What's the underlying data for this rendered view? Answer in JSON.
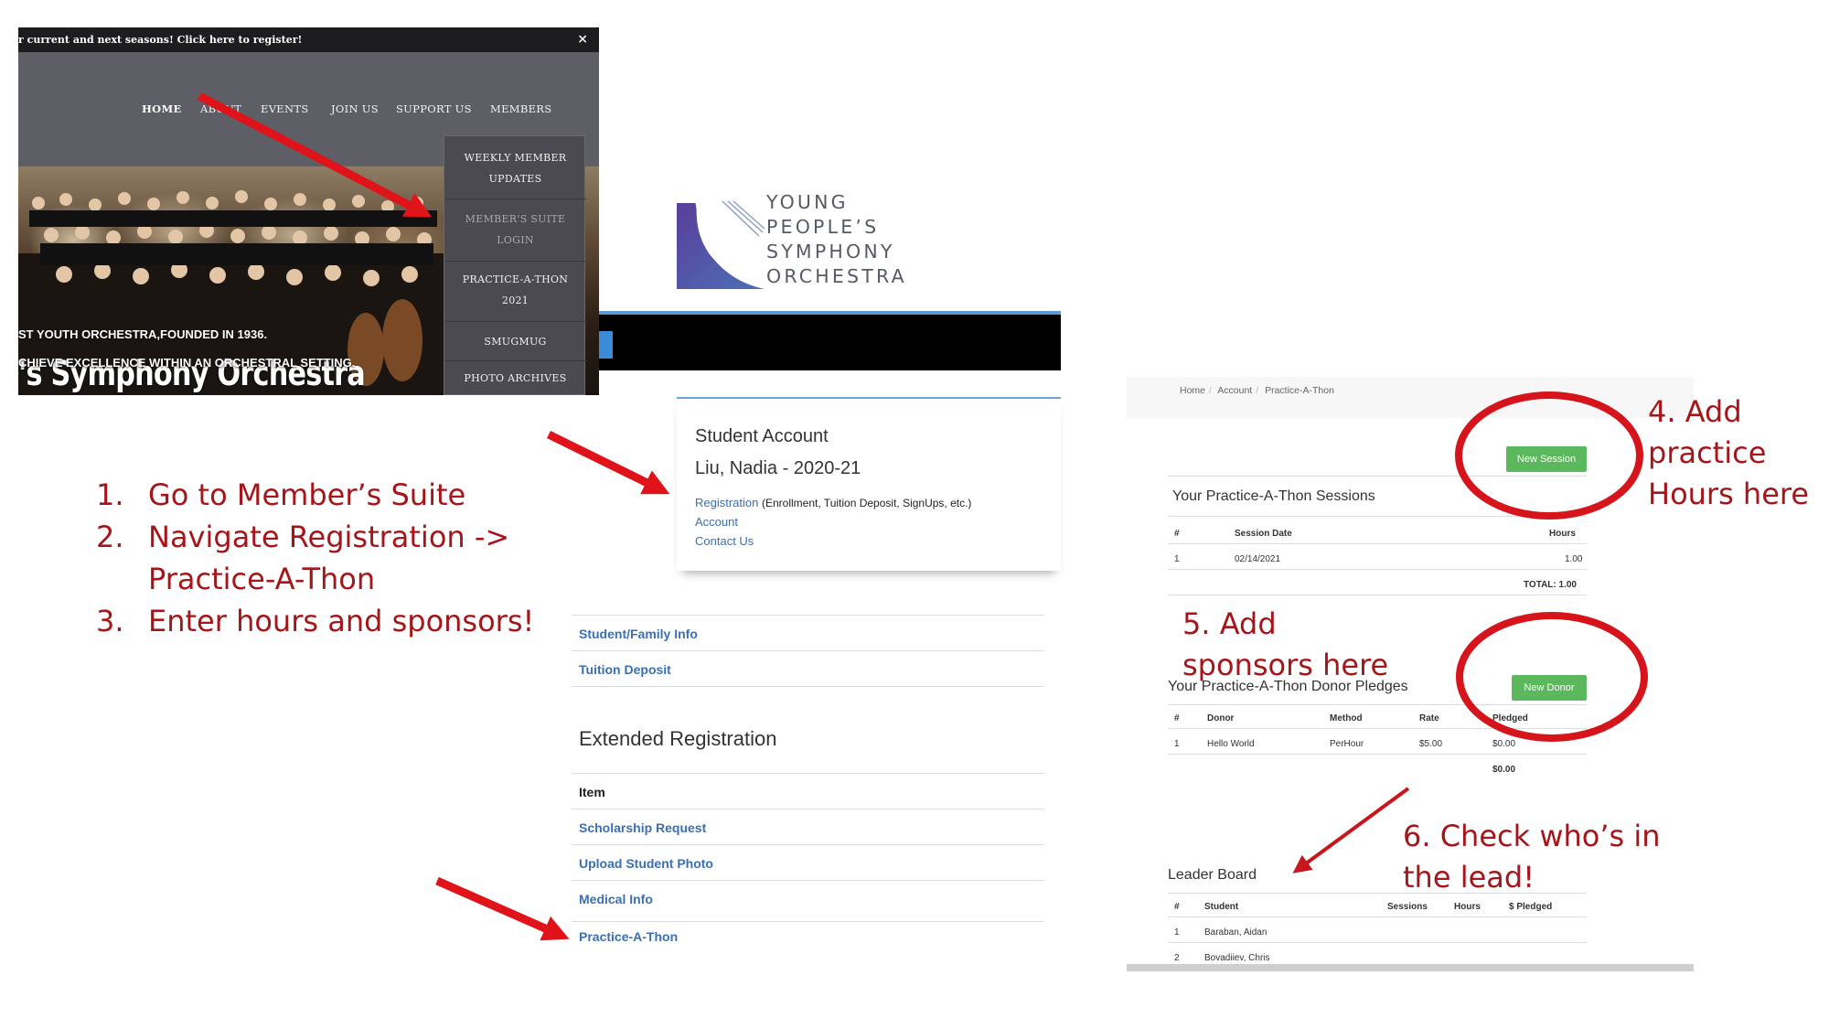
{
  "website": {
    "banner_text": "r current and next seasons! Click here to register!",
    "close_label": "×",
    "nav": [
      "HOME",
      "ABOUT",
      "EVENTS",
      "JOIN US",
      "SUPPORT US",
      "MEMBERS"
    ],
    "members_menu": [
      [
        "WEEKLY MEMBER",
        "UPDATES"
      ],
      [
        "MEMBER'S SUITE",
        "LOGIN"
      ],
      [
        "PRACTICE-A-THON",
        "2021"
      ],
      [
        "SMUGMUG"
      ],
      [
        "PHOTO ARCHIVES"
      ]
    ],
    "hero_title": "'s Symphony Orchestra",
    "hero_line1": "ST YOUTH ORCHESTRA,FOUNDED IN 1936.",
    "hero_line2": "CHIEVE EXCELLENCE WITHIN AN ORCHESTRAL SETTING."
  },
  "instructions": [
    {
      "num": "1.",
      "lines": [
        "Go to Member’s Suite"
      ]
    },
    {
      "num": "2.",
      "lines": [
        "Navigate Registration ->",
        "Practice-A-Thon"
      ]
    },
    {
      "num": "3.",
      "lines": [
        "Enter hours and sponsors!"
      ]
    }
  ],
  "logo": {
    "lines": [
      "YOUNG",
      "PEOPLE’S",
      "SYMPHONY",
      "ORCHESTRA"
    ]
  },
  "account": {
    "heading": "Student Account",
    "student": "Liu, Nadia - 2020-21",
    "registration_link": "Registration",
    "registration_note": "(Enrollment, Tuition Deposit, SignUps, etc.)",
    "account_link": "Account",
    "contact_link": "Contact Us"
  },
  "registration_links": [
    "Student/Family Info",
    "Tuition Deposit"
  ],
  "extended": {
    "title": "Extended Registration",
    "header": "Item",
    "items": [
      "Scholarship Request",
      "Upload Student Photo",
      "Medical Info",
      "Practice-A-Thon"
    ]
  },
  "pat": {
    "breadcrumb": [
      "Home",
      "Account",
      "Practice-A-Thon"
    ],
    "new_session": "New Session",
    "sessions_title": "Your Practice-A-Thon Sessions",
    "sessions_headers": [
      "#",
      "Session Date",
      "Hours"
    ],
    "sessions_rows": [
      [
        "1",
        "02/14/2021",
        "1.00"
      ]
    ],
    "sessions_total": "TOTAL: 1.00",
    "new_donor": "New Donor",
    "pledges_title": "Your Practice-A-Thon Donor Pledges",
    "pledges_headers": [
      "#",
      "Donor",
      "Method",
      "Rate",
      "Pledged"
    ],
    "pledges_rows": [
      [
        "1",
        "Hello World",
        "PerHour",
        "$5.00",
        "$0.00"
      ]
    ],
    "pledges_total": "$0.00",
    "leader_title": "Leader Board",
    "leader_headers": [
      "#",
      "Student",
      "Sessions",
      "Hours",
      "$ Pledged"
    ],
    "leader_rows": [
      [
        "1",
        "Baraban, Aidan"
      ],
      [
        "2",
        "Bovadiiev, Chris"
      ]
    ]
  },
  "annotations": {
    "step4": [
      "4. Add",
      "practice",
      "Hours here"
    ],
    "step5": [
      "5. Add",
      "sponsors here"
    ],
    "step6": [
      "6. Check who’s in",
      "the lead!"
    ]
  },
  "colors": {
    "annotation": "#a4161a",
    "link": "#3a6fb6",
    "button": "#5cb85c",
    "nav_bg": "#5e5e66"
  }
}
